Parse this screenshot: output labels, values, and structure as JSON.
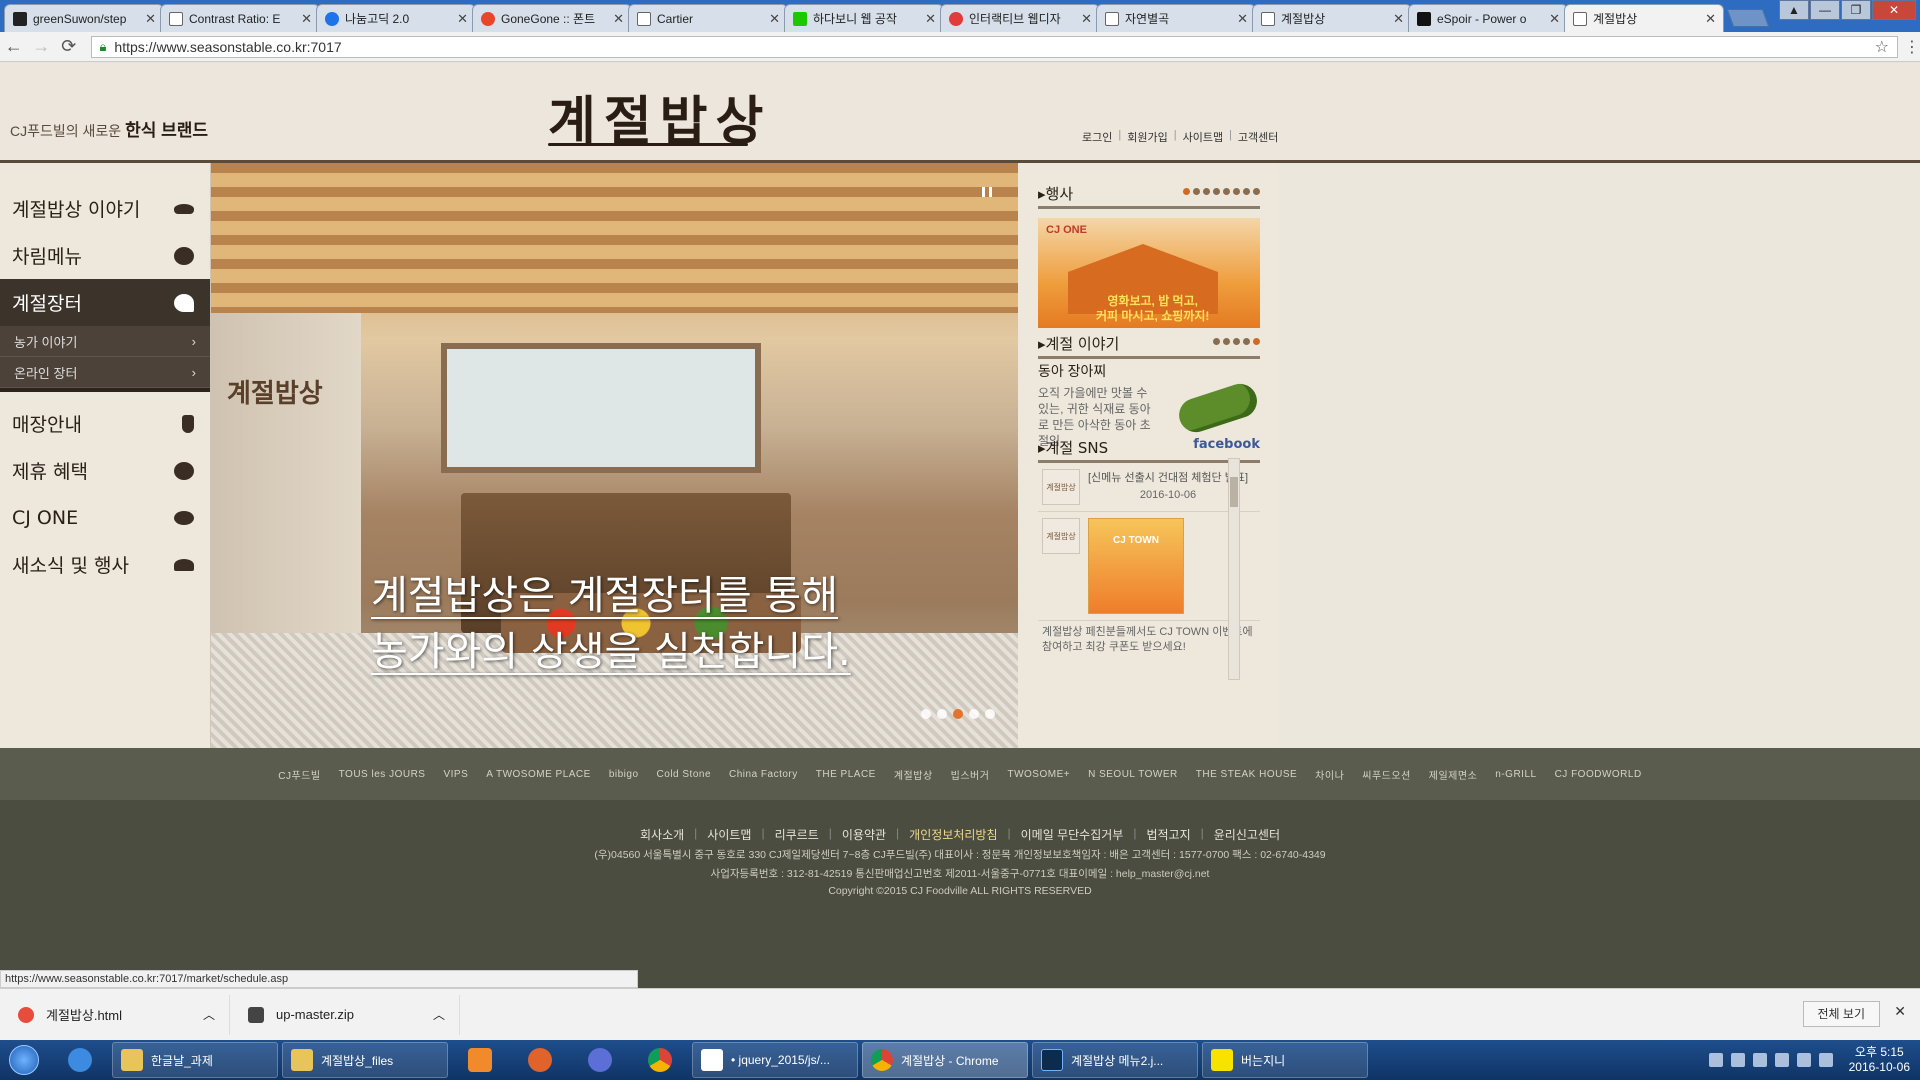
{
  "browser": {
    "tabs": [
      {
        "title": "greenSuwon/step",
        "active": false
      },
      {
        "title": "Contrast Ratio: E",
        "active": false
      },
      {
        "title": "나눔고딕 2.0",
        "active": false
      },
      {
        "title": "GoneGone :: 폰트",
        "active": false
      },
      {
        "title": "Cartier",
        "active": false
      },
      {
        "title": "하다보니 웹 공작",
        "active": false
      },
      {
        "title": "인터랙티브 웹디자",
        "active": false
      },
      {
        "title": "자연별곡",
        "active": false
      },
      {
        "title": "계절밥상",
        "active": false
      },
      {
        "title": "eSpoir - Power o",
        "active": false
      },
      {
        "title": "계절밥상",
        "active": true
      }
    ],
    "url": "https://www.seasonstable.co.kr:7017",
    "status_url": "https://www.seasonstable.co.kr:7017/market/schedule.asp"
  },
  "header": {
    "tagline_prefix": "CJ푸드빌의 새로운",
    "tagline_bold": "한식 브랜드",
    "logo": "계절밥상",
    "util_links": [
      "로그인",
      "회원가입",
      "사이트맵",
      "고객센터"
    ]
  },
  "nav": {
    "items": [
      {
        "label": "계절밥상 이야기",
        "icon": "bowl-icon"
      },
      {
        "label": "차림메뉴",
        "icon": "leaf-icon"
      },
      {
        "label": "계절장터",
        "icon": "cabbage-icon",
        "active": true
      },
      {
        "label": "매장안내",
        "icon": "pepper-icon"
      },
      {
        "label": "제휴 혜택",
        "icon": "bean-icon"
      },
      {
        "label": "CJ ONE",
        "icon": "chestnut-icon"
      },
      {
        "label": "새소식 및 행사",
        "icon": "mushroom-icon"
      }
    ],
    "sub_items": [
      "농가 이야기",
      "온라인 장터"
    ]
  },
  "hero": {
    "store_logo": "계절밥상",
    "line1": "계절밥상은 계절장터를 통해",
    "line2": "농가와의 상생을 실천합니다.",
    "active_slide": 3,
    "slide_count": 5
  },
  "side": {
    "event": {
      "title": "행사",
      "brand": "CJ ONE",
      "line1": "영화보고, 밥 먹고,",
      "line2": "커피 마시고, 쇼핑까지!"
    },
    "story": {
      "title": "계절 이야기",
      "item_title": "동아 장아찌",
      "body": "오직 가을에만 맛볼 수 있는, 귀한 식재료 동아로 만든 아삭한 동아 초절임"
    },
    "sns": {
      "title": "계절 SNS",
      "network": "facebook",
      "post1": "[신메뉴 선출시 건대점 체험단 발표]",
      "post1_date": "2016-10-06",
      "thumb_label": "계절밥상",
      "promo_title": "CJ TOWN",
      "post2": "계절밥상 페친분들께서도 CJ TOWN 이벤트에 참여하고 최강 쿠폰도 받으세요!"
    }
  },
  "brands": [
    "CJ푸드빌",
    "TOUS les JOURS",
    "VIPS",
    "A TWOSOME PLACE",
    "bibigo",
    "Cold Stone",
    "China Factory",
    "THE PLACE",
    "계절밥상",
    "빕스버거",
    "TWOSOME+",
    "N SEOUL TOWER",
    "THE STEAK HOUSE",
    "차이나",
    "씨푸드오션",
    "제일제면소",
    "n-GRILL",
    "CJ FOODWORLD"
  ],
  "footer": {
    "links": [
      "회사소개",
      "사이트맵",
      "리쿠르트",
      "이용약관",
      "개인정보처리방침",
      "이메일 무단수집거부",
      "법적고지",
      "윤리신고센터"
    ],
    "address": "(우)04560 서울특별시 중구 동호로 330 CJ제일제당센터 7~8층 CJ푸드빌(주)   대표이사 : 정문목   개인정보보호책임자 : 배은   고객센터 : 1577-0700   팩스 : 02-6740-4349",
    "biz": "사업자등록번호 : 312-81-42519   통신판매업신고번호 제2011-서울중구-0771호   대표이메일 : help_master@cj.net",
    "copyright": "Copyright ©2015 CJ Foodville ALL RIGHTS RESERVED"
  },
  "downloads": [
    {
      "name": "계절밥상.html"
    },
    {
      "name": "up-master.zip"
    }
  ],
  "download_showall": "전체 보기",
  "taskbar": {
    "tasks": [
      "한글날_과제",
      "계절밥상_files",
      "• jquery_2015/js/...",
      "계절밥상 - Chrome",
      "계절밥상 메뉴2.j...",
      "버는지니"
    ],
    "time": "오후 5:15",
    "date": "2016-10-06"
  }
}
